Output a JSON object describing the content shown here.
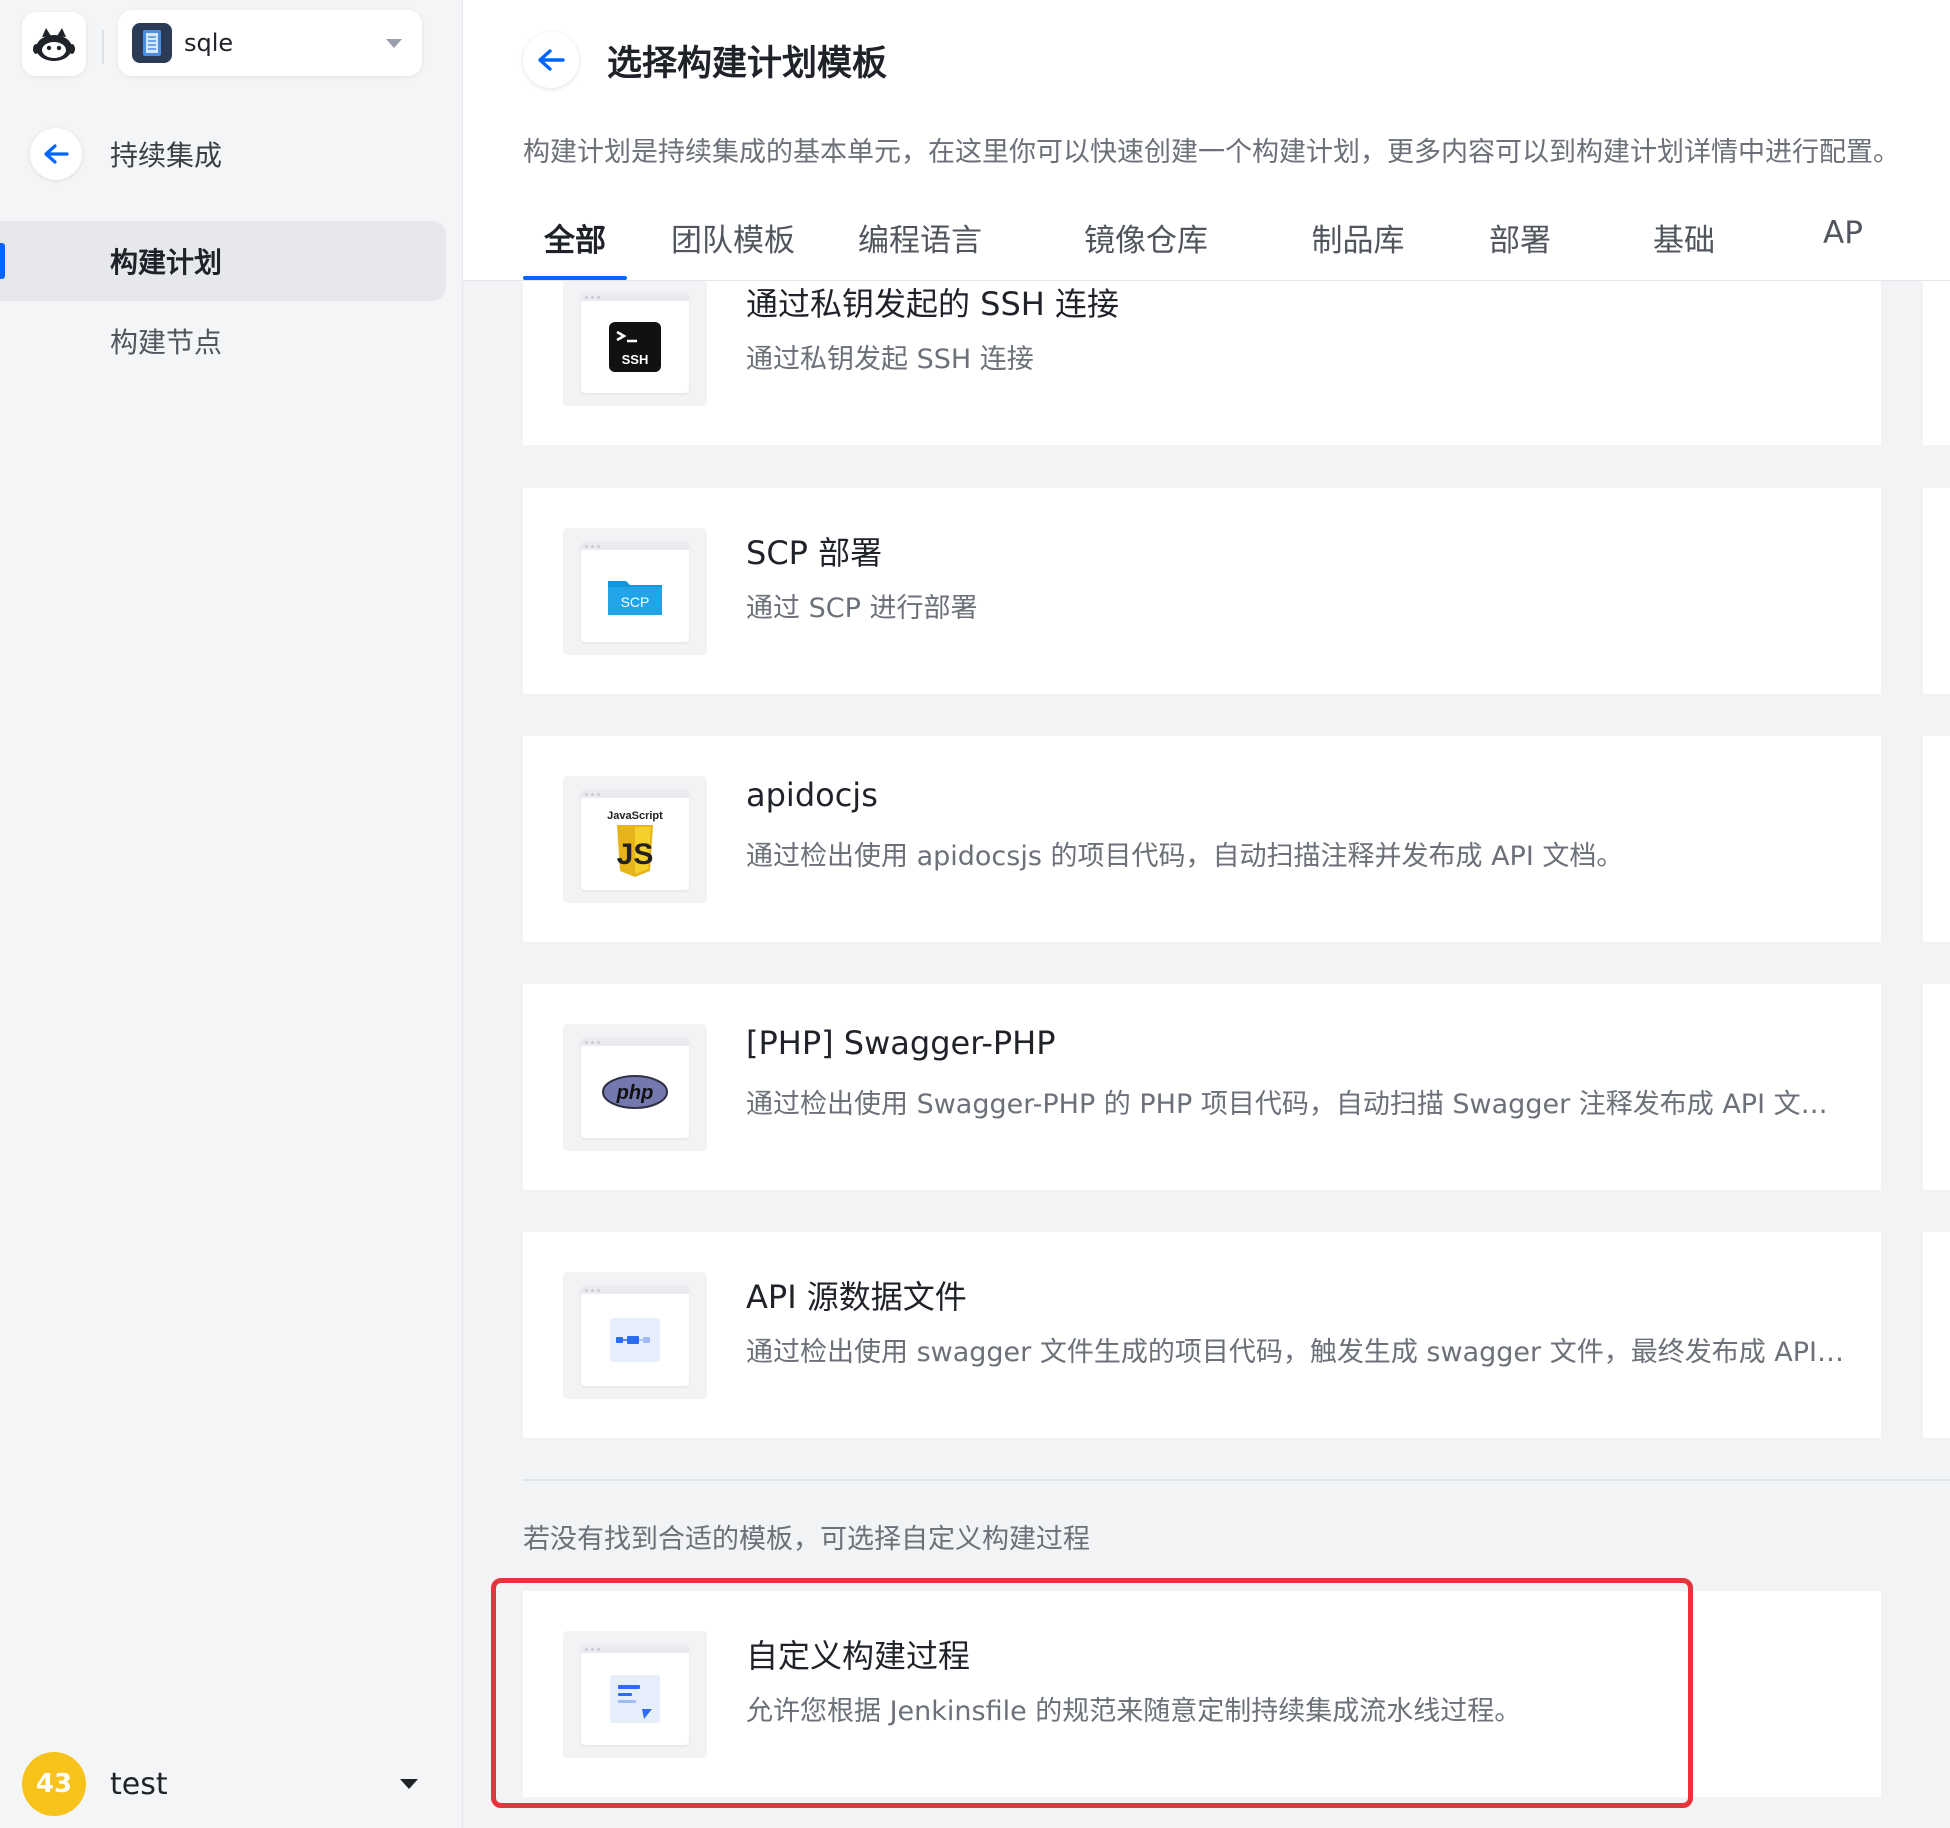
{
  "project": {
    "name": "sqle"
  },
  "sidebar": {
    "back_label": "持续集成",
    "items": [
      {
        "label": "构建计划",
        "active": true
      },
      {
        "label": "构建节点",
        "active": false
      }
    ]
  },
  "user": {
    "badge": "43",
    "name": "test"
  },
  "header": {
    "title": "选择构建计划模板",
    "description": "构建计划是持续集成的基本单元，在这里你可以快速创建一个构建计划，更多内容可以到构建计划详情中进行配置。",
    "tabs": [
      "全部",
      "团队模板",
      "编程语言",
      "镜像仓库",
      "制品库",
      "部署",
      "基础",
      "AP"
    ]
  },
  "templates": [
    {
      "title": "通过私钥发起的 SSH 连接",
      "description": "通过私钥发起 SSH 连接",
      "icon": "ssh-terminal-icon",
      "icon_text": "SSH"
    },
    {
      "title": "SCP 部署",
      "description": "通过 SCP 进行部署",
      "icon": "scp-folder-icon",
      "icon_text": "SCP"
    },
    {
      "title": "apidocjs",
      "description": "通过检出使用 apidocsjs 的项目代码，自动扫描注释并发布成 API 文档。",
      "icon": "javascript-icon",
      "icon_text": "JavaScript"
    },
    {
      "title": "[PHP] Swagger-PHP",
      "description": "通过检出使用 Swagger-PHP 的 PHP 项目代码，自动扫描 Swagger 注释发布成 API 文档。",
      "icon": "php-icon",
      "icon_text": "php"
    },
    {
      "title": "API 源数据文件",
      "description": "通过检出使用 swagger 文件生成的项目代码，触发生成 swagger 文件，最终发布成 API 文档。",
      "icon": "api-flow-icon"
    }
  ],
  "custom": {
    "hint": "若没有找到合适的模板，可选择自定义构建过程",
    "title": "自定义构建过程",
    "description": "允许您根据 Jenkinsfile 的规范来随意定制持续集成流水线过程。",
    "icon": "document-edit-icon"
  },
  "colors": {
    "accent": "#0066ff",
    "highlight": "#e8333d",
    "avatar": "#f7c21a"
  }
}
